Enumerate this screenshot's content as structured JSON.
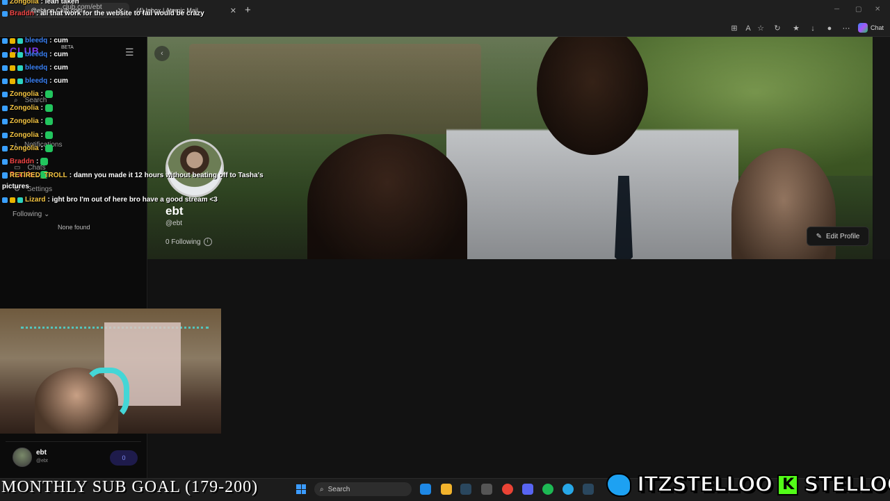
{
  "browser": {
    "tabs": [
      {
        "label": "@ebt on Club.com",
        "close": "✕"
      },
      {
        "label": "(4) Inbox | Atomic Mail",
        "close": "✕"
      }
    ],
    "new_tab": "+",
    "url": "club.com/ebt",
    "chat_label": "Chat"
  },
  "sidebar": {
    "logo": "CLUB",
    "beta": "BETA",
    "nav": {
      "search": "Search",
      "notifications": "Notifications",
      "chats": "Chats",
      "settings": "Settings"
    },
    "following_label": "Following",
    "none_found": "None found",
    "user": {
      "name": "ebt",
      "handle": "@ebt",
      "toggle": "0"
    }
  },
  "profile": {
    "name": "ebt",
    "handle": "@ebt",
    "following": "0 Following",
    "edit_profile": "Edit Profile"
  },
  "chat_overlay": [
    {
      "user": "Zongolia",
      "color": "#f5c542",
      "text": ": lean taken"
    },
    {
      "user": "Braddn",
      "color": "#ef4444",
      "text": ": all that work for the website to fail would be crazy"
    },
    {
      "user": "bleedq",
      "color": "#3b82f6",
      "text": ": cum"
    },
    {
      "user": "bleedq",
      "color": "#3b82f6",
      "text": ": cum"
    },
    {
      "user": "bleedq",
      "color": "#3b82f6",
      "text": ": cum"
    },
    {
      "user": "bleedq",
      "color": "#3b82f6",
      "text": ": cum"
    },
    {
      "user": "Zongolia",
      "color": "#f5c542",
      "text": ":"
    },
    {
      "user": "Zongolia",
      "color": "#f5c542",
      "text": ":"
    },
    {
      "user": "Zongolia",
      "color": "#f5c542",
      "text": ":"
    },
    {
      "user": "Zongolia",
      "color": "#f5c542",
      "text": ":"
    },
    {
      "user": "Zongolia",
      "color": "#f5c542",
      "text": ":"
    },
    {
      "user": "Braddn",
      "color": "#ef4444",
      "text": ":"
    },
    {
      "user": "Braddn",
      "color": "#ef4444",
      "text": ":"
    },
    {
      "user": "RETIRED_TROLL",
      "color": "#f5c542",
      "text": ": damn you made it 12 hours without beating off to Tasha's"
    },
    {
      "user": "",
      "color": "#ffffff",
      "text": "pictures"
    },
    {
      "user": "Lizard",
      "color": "#f5c542",
      "text": ": ight bro I'm out of here bro have a good stream <3"
    }
  ],
  "stream": {
    "sub_goal": "MONTHLY SUB GOAL (179-200)",
    "twitter": "ITZSTELLOO",
    "kick_letter": "K",
    "kick": "STELLOOO"
  },
  "taskbar": {
    "search": "Search"
  },
  "colors": {
    "accent": "#7c3aed",
    "background": "#121212"
  }
}
